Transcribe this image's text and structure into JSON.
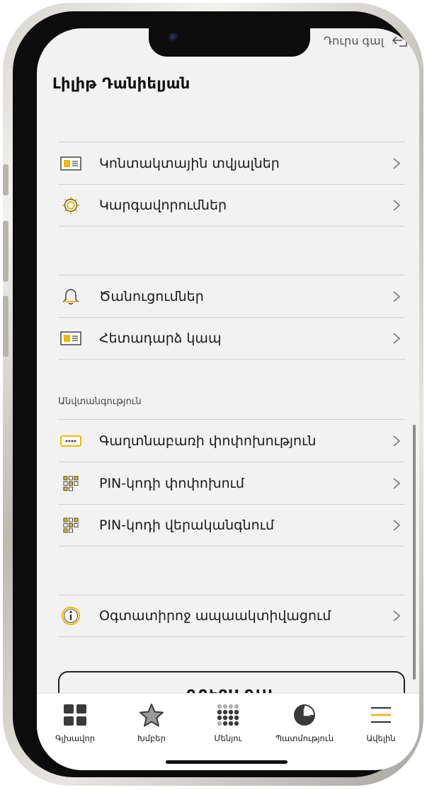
{
  "header": {
    "user_name": "Լիլիթ Դանիելյան",
    "logout_link": "Դուրս գալ"
  },
  "groups": [
    {
      "items": [
        {
          "label": "Կոնտակտային տվյալներ",
          "icon": "contact-card-icon"
        },
        {
          "label": "Կարգավորումներ",
          "icon": "gear-icon"
        }
      ]
    },
    {
      "items": [
        {
          "label": "Ծանուցումներ",
          "icon": "bell-icon"
        },
        {
          "label": "Հետադարձ կապ",
          "icon": "contact-card-icon"
        }
      ]
    },
    {
      "header": "Անվտանգություն",
      "items": [
        {
          "label": "Գաղտնաբառի փոփոխություն",
          "icon": "password-field-icon"
        },
        {
          "label": "PIN-կոդի փոփոխում",
          "icon": "keypad-icon"
        },
        {
          "label": "PIN-կոդի վերականգնում",
          "icon": "keypad-icon"
        }
      ]
    },
    {
      "items": [
        {
          "label": "Օգտատիրոջ ապաակտիվացում",
          "icon": "info-icon"
        }
      ]
    }
  ],
  "logout_button": "ԴՈՒՐՍ ԳԱԼ",
  "tabbar": [
    {
      "label": "Գլխավոր",
      "icon": "dashboard-grid-icon"
    },
    {
      "label": "Խմբեր",
      "icon": "star-icon"
    },
    {
      "label": "Մենյու",
      "icon": "dots-grid-icon"
    },
    {
      "label": "Պատմություն",
      "icon": "history-clock-icon"
    },
    {
      "label": "Ավելին",
      "icon": "hamburger-menu-icon"
    }
  ],
  "colors": {
    "accent": "#f5b800",
    "background": "#f2f2f2",
    "divider": "#d2d2d2",
    "text": "#1a1a1a"
  }
}
